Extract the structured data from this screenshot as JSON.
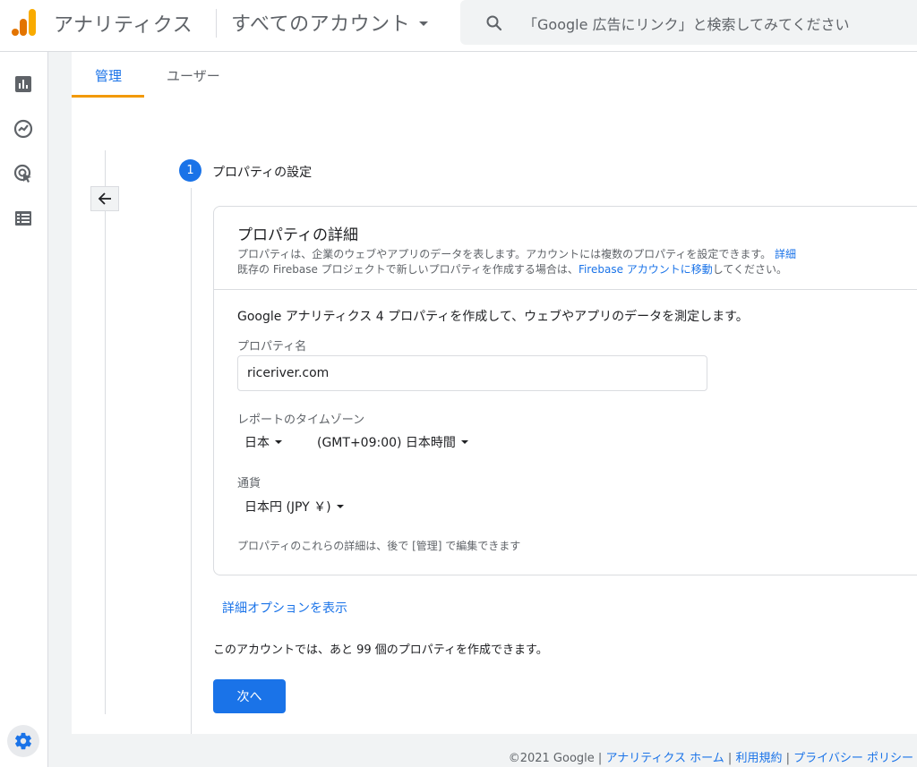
{
  "header": {
    "app_title": "アナリティクス",
    "account_selector": "すべてのアカウント",
    "search_placeholder": "「Google 広告にリンク」と検索してみてください"
  },
  "nav": {
    "icons": [
      "reports-icon",
      "explore-icon",
      "advertising-icon",
      "configure-icon"
    ],
    "settings_icon": "gear-icon"
  },
  "tabs": [
    {
      "label": "管理",
      "active": true
    },
    {
      "label": "ユーザー",
      "active": false
    }
  ],
  "step": {
    "number": "1",
    "title": "プロパティの設定"
  },
  "card": {
    "title": "プロパティの詳細",
    "desc_line1": "プロパティは、企業のウェブやアプリのデータを表します。アカウントには複数のプロパティを設定できます。",
    "desc_line1_link": "詳細",
    "desc_line2_prefix": "既存の Firebase プロジェクトで新しいプロパティを作成する場合は、",
    "desc_line2_link": "Firebase アカウントに移動",
    "desc_line2_suffix": "してください。",
    "intro": "Google アナリティクス 4 プロパティを作成して、ウェブやアプリのデータを測定します。",
    "property_name_label": "プロパティ名",
    "property_name_value": "riceriver.com",
    "timezone_label": "レポートのタイムゾーン",
    "timezone_country": "日本",
    "timezone_value": "(GMT+09:00) 日本時間",
    "currency_label": "通貨",
    "currency_value": "日本円 (JPY ￥)",
    "note": "プロパティのこれらの詳細は、後で [管理] で編集できます"
  },
  "advanced_link": "詳細オプションを表示",
  "remaining_text": "このアカウントでは、あと 99 個のプロパティを作成できます。",
  "next_button": "次へ",
  "footer": {
    "copyright": "©2021 Google",
    "links": [
      "アナリティクス ホーム",
      "利用規約",
      "プライバシー ポリシー"
    ]
  },
  "colors": {
    "accent": "#1a73e8",
    "tab_indicator": "#f29900",
    "logo_orange": "#f9ab00",
    "logo_dark_orange": "#e37400"
  }
}
